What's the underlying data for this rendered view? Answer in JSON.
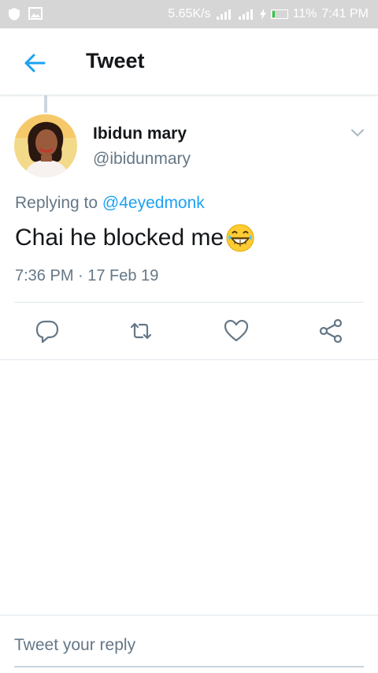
{
  "status_bar": {
    "speed": "5.65K/s",
    "battery": "11%",
    "time": "7:41 PM"
  },
  "header": {
    "title": "Tweet"
  },
  "tweet": {
    "author_name": "Ibidun mary",
    "author_handle": "@ibidunmary",
    "replying_prefix": "Replying to",
    "replying_to": "@4eyedmonk",
    "text": "Chai he blocked me",
    "emoji": "face-with-tears-of-joy",
    "timestamp": "7:36 PM · 17 Feb 19"
  },
  "actions": {
    "icons": [
      "reply-icon",
      "retweet-icon",
      "like-icon",
      "share-icon"
    ]
  },
  "reply_box": {
    "placeholder": "Tweet your reply"
  },
  "colors": {
    "accent": "#1da1f2",
    "text_primary": "#14171a",
    "text_secondary": "#657786",
    "status_bar": "#d6d6d6"
  }
}
